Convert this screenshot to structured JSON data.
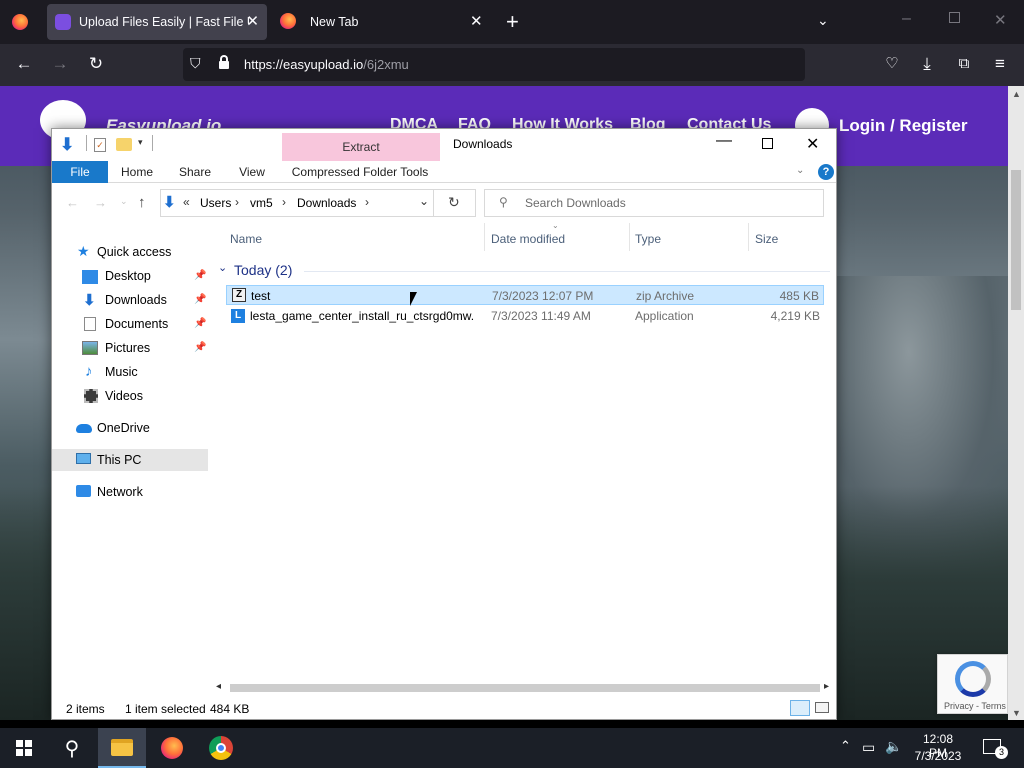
{
  "browser": {
    "tabs": [
      {
        "title": "Upload Files Easily | Fast File Up"
      },
      {
        "title": "New Tab"
      }
    ],
    "url": {
      "host": "https://easyupload.io",
      "path": "/6j2xmu"
    }
  },
  "site": {
    "logo": "Easyupload.io",
    "nav": [
      "DMCA",
      "FAQ",
      "How It Works",
      "Blog",
      "Contact Us"
    ],
    "login": "Login / Register"
  },
  "explorer": {
    "title": "Downloads",
    "context_tab": "Extract",
    "ribbon_tabs": [
      "File",
      "Home",
      "Share",
      "View",
      "Compressed Folder Tools"
    ],
    "breadcrumb": [
      "Users",
      "vm5",
      "Downloads"
    ],
    "search_placeholder": "Search Downloads",
    "nav": [
      {
        "label": "Quick access",
        "icon": "star-icon"
      },
      {
        "label": "Desktop",
        "icon": "desktop-folder-icon",
        "pinned": true
      },
      {
        "label": "Downloads",
        "icon": "downloads-folder-icon",
        "pinned": true
      },
      {
        "label": "Documents",
        "icon": "documents-folder-icon",
        "pinned": true
      },
      {
        "label": "Pictures",
        "icon": "pictures-folder-icon",
        "pinned": true
      },
      {
        "label": "Music",
        "icon": "music-folder-icon"
      },
      {
        "label": "Videos",
        "icon": "videos-folder-icon"
      },
      {
        "label": "OneDrive",
        "icon": "cloud-icon"
      },
      {
        "label": "This PC",
        "icon": "computer-icon"
      },
      {
        "label": "Network",
        "icon": "network-icon"
      }
    ],
    "columns": [
      "Name",
      "Date modified",
      "Type",
      "Size"
    ],
    "group": "Today (2)",
    "files": [
      {
        "name": "test",
        "date": "7/3/2023 12:07 PM",
        "type": "zip Archive",
        "size": "485 KB",
        "selected": true
      },
      {
        "name": "lesta_game_center_install_ru_ctsrgd0mw...",
        "date": "7/3/2023 11:49 AM",
        "type": "Application",
        "size": "4,219 KB",
        "selected": false
      }
    ],
    "status": {
      "items": "2 items",
      "selected": "1 item selected",
      "size": "484 KB"
    }
  },
  "recaptcha": {
    "links": "Privacy - Terms"
  },
  "taskbar": {
    "time": "12:08 PM",
    "date": "7/3/2023",
    "notifications": "3"
  }
}
